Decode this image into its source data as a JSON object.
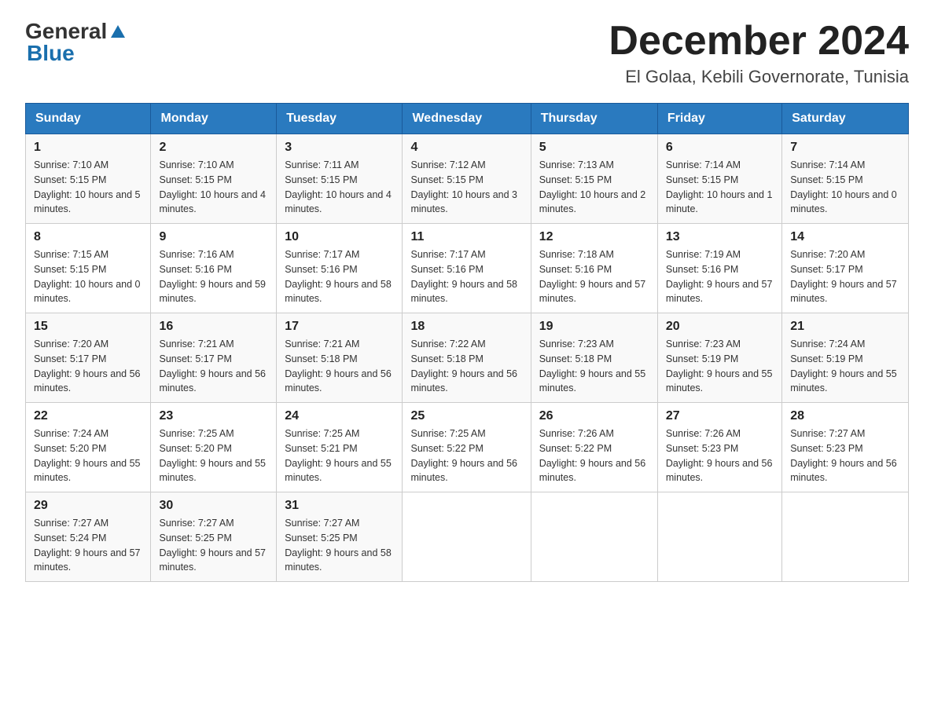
{
  "header": {
    "logo_general": "General",
    "logo_blue": "Blue",
    "month_title": "December 2024",
    "location": "El Golaa, Kebili Governorate, Tunisia"
  },
  "weekdays": [
    "Sunday",
    "Monday",
    "Tuesday",
    "Wednesday",
    "Thursday",
    "Friday",
    "Saturday"
  ],
  "weeks": [
    [
      {
        "day": "1",
        "sunrise": "7:10 AM",
        "sunset": "5:15 PM",
        "daylight": "10 hours and 5 minutes."
      },
      {
        "day": "2",
        "sunrise": "7:10 AM",
        "sunset": "5:15 PM",
        "daylight": "10 hours and 4 minutes."
      },
      {
        "day": "3",
        "sunrise": "7:11 AM",
        "sunset": "5:15 PM",
        "daylight": "10 hours and 4 minutes."
      },
      {
        "day": "4",
        "sunrise": "7:12 AM",
        "sunset": "5:15 PM",
        "daylight": "10 hours and 3 minutes."
      },
      {
        "day": "5",
        "sunrise": "7:13 AM",
        "sunset": "5:15 PM",
        "daylight": "10 hours and 2 minutes."
      },
      {
        "day": "6",
        "sunrise": "7:14 AM",
        "sunset": "5:15 PM",
        "daylight": "10 hours and 1 minute."
      },
      {
        "day": "7",
        "sunrise": "7:14 AM",
        "sunset": "5:15 PM",
        "daylight": "10 hours and 0 minutes."
      }
    ],
    [
      {
        "day": "8",
        "sunrise": "7:15 AM",
        "sunset": "5:15 PM",
        "daylight": "10 hours and 0 minutes."
      },
      {
        "day": "9",
        "sunrise": "7:16 AM",
        "sunset": "5:16 PM",
        "daylight": "9 hours and 59 minutes."
      },
      {
        "day": "10",
        "sunrise": "7:17 AM",
        "sunset": "5:16 PM",
        "daylight": "9 hours and 58 minutes."
      },
      {
        "day": "11",
        "sunrise": "7:17 AM",
        "sunset": "5:16 PM",
        "daylight": "9 hours and 58 minutes."
      },
      {
        "day": "12",
        "sunrise": "7:18 AM",
        "sunset": "5:16 PM",
        "daylight": "9 hours and 57 minutes."
      },
      {
        "day": "13",
        "sunrise": "7:19 AM",
        "sunset": "5:16 PM",
        "daylight": "9 hours and 57 minutes."
      },
      {
        "day": "14",
        "sunrise": "7:20 AM",
        "sunset": "5:17 PM",
        "daylight": "9 hours and 57 minutes."
      }
    ],
    [
      {
        "day": "15",
        "sunrise": "7:20 AM",
        "sunset": "5:17 PM",
        "daylight": "9 hours and 56 minutes."
      },
      {
        "day": "16",
        "sunrise": "7:21 AM",
        "sunset": "5:17 PM",
        "daylight": "9 hours and 56 minutes."
      },
      {
        "day": "17",
        "sunrise": "7:21 AM",
        "sunset": "5:18 PM",
        "daylight": "9 hours and 56 minutes."
      },
      {
        "day": "18",
        "sunrise": "7:22 AM",
        "sunset": "5:18 PM",
        "daylight": "9 hours and 56 minutes."
      },
      {
        "day": "19",
        "sunrise": "7:23 AM",
        "sunset": "5:18 PM",
        "daylight": "9 hours and 55 minutes."
      },
      {
        "day": "20",
        "sunrise": "7:23 AM",
        "sunset": "5:19 PM",
        "daylight": "9 hours and 55 minutes."
      },
      {
        "day": "21",
        "sunrise": "7:24 AM",
        "sunset": "5:19 PM",
        "daylight": "9 hours and 55 minutes."
      }
    ],
    [
      {
        "day": "22",
        "sunrise": "7:24 AM",
        "sunset": "5:20 PM",
        "daylight": "9 hours and 55 minutes."
      },
      {
        "day": "23",
        "sunrise": "7:25 AM",
        "sunset": "5:20 PM",
        "daylight": "9 hours and 55 minutes."
      },
      {
        "day": "24",
        "sunrise": "7:25 AM",
        "sunset": "5:21 PM",
        "daylight": "9 hours and 55 minutes."
      },
      {
        "day": "25",
        "sunrise": "7:25 AM",
        "sunset": "5:22 PM",
        "daylight": "9 hours and 56 minutes."
      },
      {
        "day": "26",
        "sunrise": "7:26 AM",
        "sunset": "5:22 PM",
        "daylight": "9 hours and 56 minutes."
      },
      {
        "day": "27",
        "sunrise": "7:26 AM",
        "sunset": "5:23 PM",
        "daylight": "9 hours and 56 minutes."
      },
      {
        "day": "28",
        "sunrise": "7:27 AM",
        "sunset": "5:23 PM",
        "daylight": "9 hours and 56 minutes."
      }
    ],
    [
      {
        "day": "29",
        "sunrise": "7:27 AM",
        "sunset": "5:24 PM",
        "daylight": "9 hours and 57 minutes."
      },
      {
        "day": "30",
        "sunrise": "7:27 AM",
        "sunset": "5:25 PM",
        "daylight": "9 hours and 57 minutes."
      },
      {
        "day": "31",
        "sunrise": "7:27 AM",
        "sunset": "5:25 PM",
        "daylight": "9 hours and 58 minutes."
      },
      null,
      null,
      null,
      null
    ]
  ]
}
